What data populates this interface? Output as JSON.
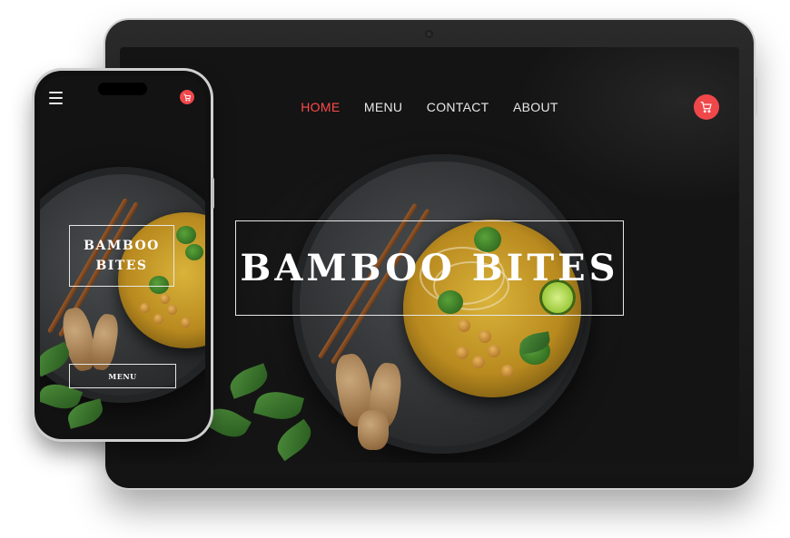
{
  "tablet": {
    "nav": {
      "items": [
        {
          "label": "HOME",
          "active": true
        },
        {
          "label": "MENU",
          "active": false
        },
        {
          "label": "CONTACT",
          "active": false
        },
        {
          "label": "ABOUT",
          "active": false
        }
      ],
      "cart_icon": "cart-icon"
    },
    "hero": {
      "title": "BAMBOO BITES"
    }
  },
  "phone": {
    "menu_icon": "hamburger-icon",
    "cart_icon": "cart-icon",
    "hero": {
      "title": "BAMBOO BITES"
    },
    "menu_button": {
      "label": "MENU"
    }
  },
  "colors": {
    "accent": "#f0474b",
    "active_nav": "#ff4a4a",
    "background": "#141414",
    "text": "#e8e8e8"
  }
}
